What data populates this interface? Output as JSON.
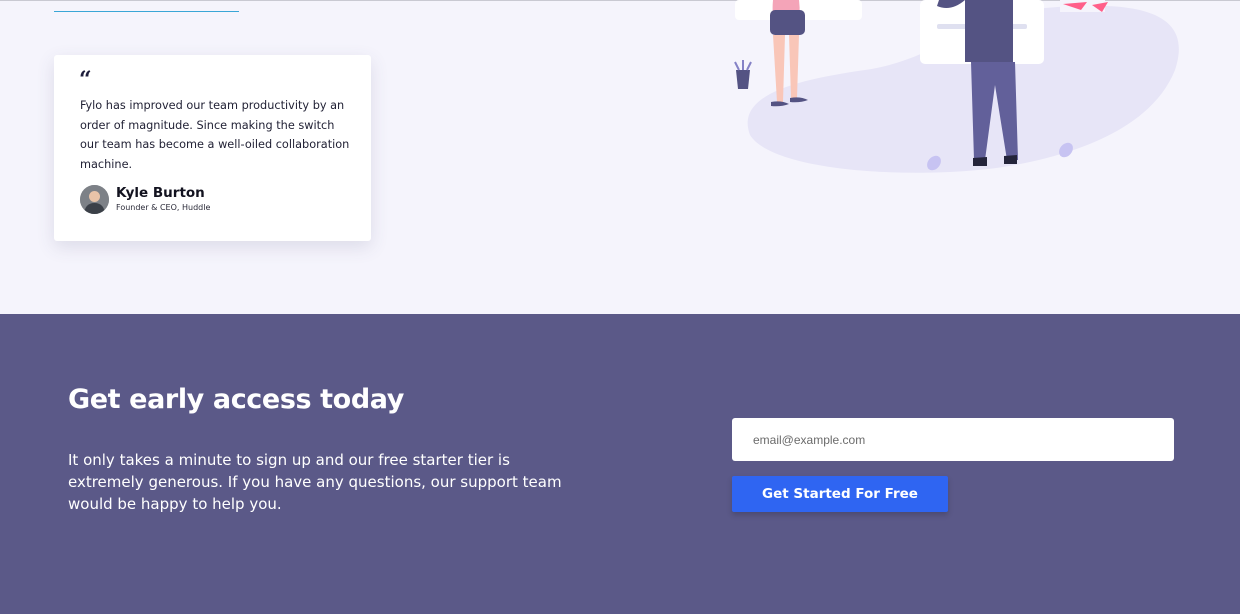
{
  "testimonial": {
    "quote_mark": "“",
    "text": "Fylo has improved our team productivity by an order of magnitude. Since making the switch our team has become a well-oiled collaboration machine.",
    "author_name": "Kyle Burton",
    "author_role": "Founder & CEO, Huddle"
  },
  "cta": {
    "title": "Get early access today",
    "description": "It only takes a minute to sign up and our free starter tier is extremely generous. If you have any questions, our support team would be happy to help you.",
    "email_placeholder": "email@example.com",
    "email_value": "",
    "button_label": "Get Started For Free"
  },
  "colors": {
    "page_background": "#f5f4fc",
    "cta_background": "#5b5988",
    "button": "#2f65f2",
    "link_underline": "#3aa6d6"
  },
  "icons": [
    "quote-icon",
    "avatar",
    "team-illustration"
  ]
}
